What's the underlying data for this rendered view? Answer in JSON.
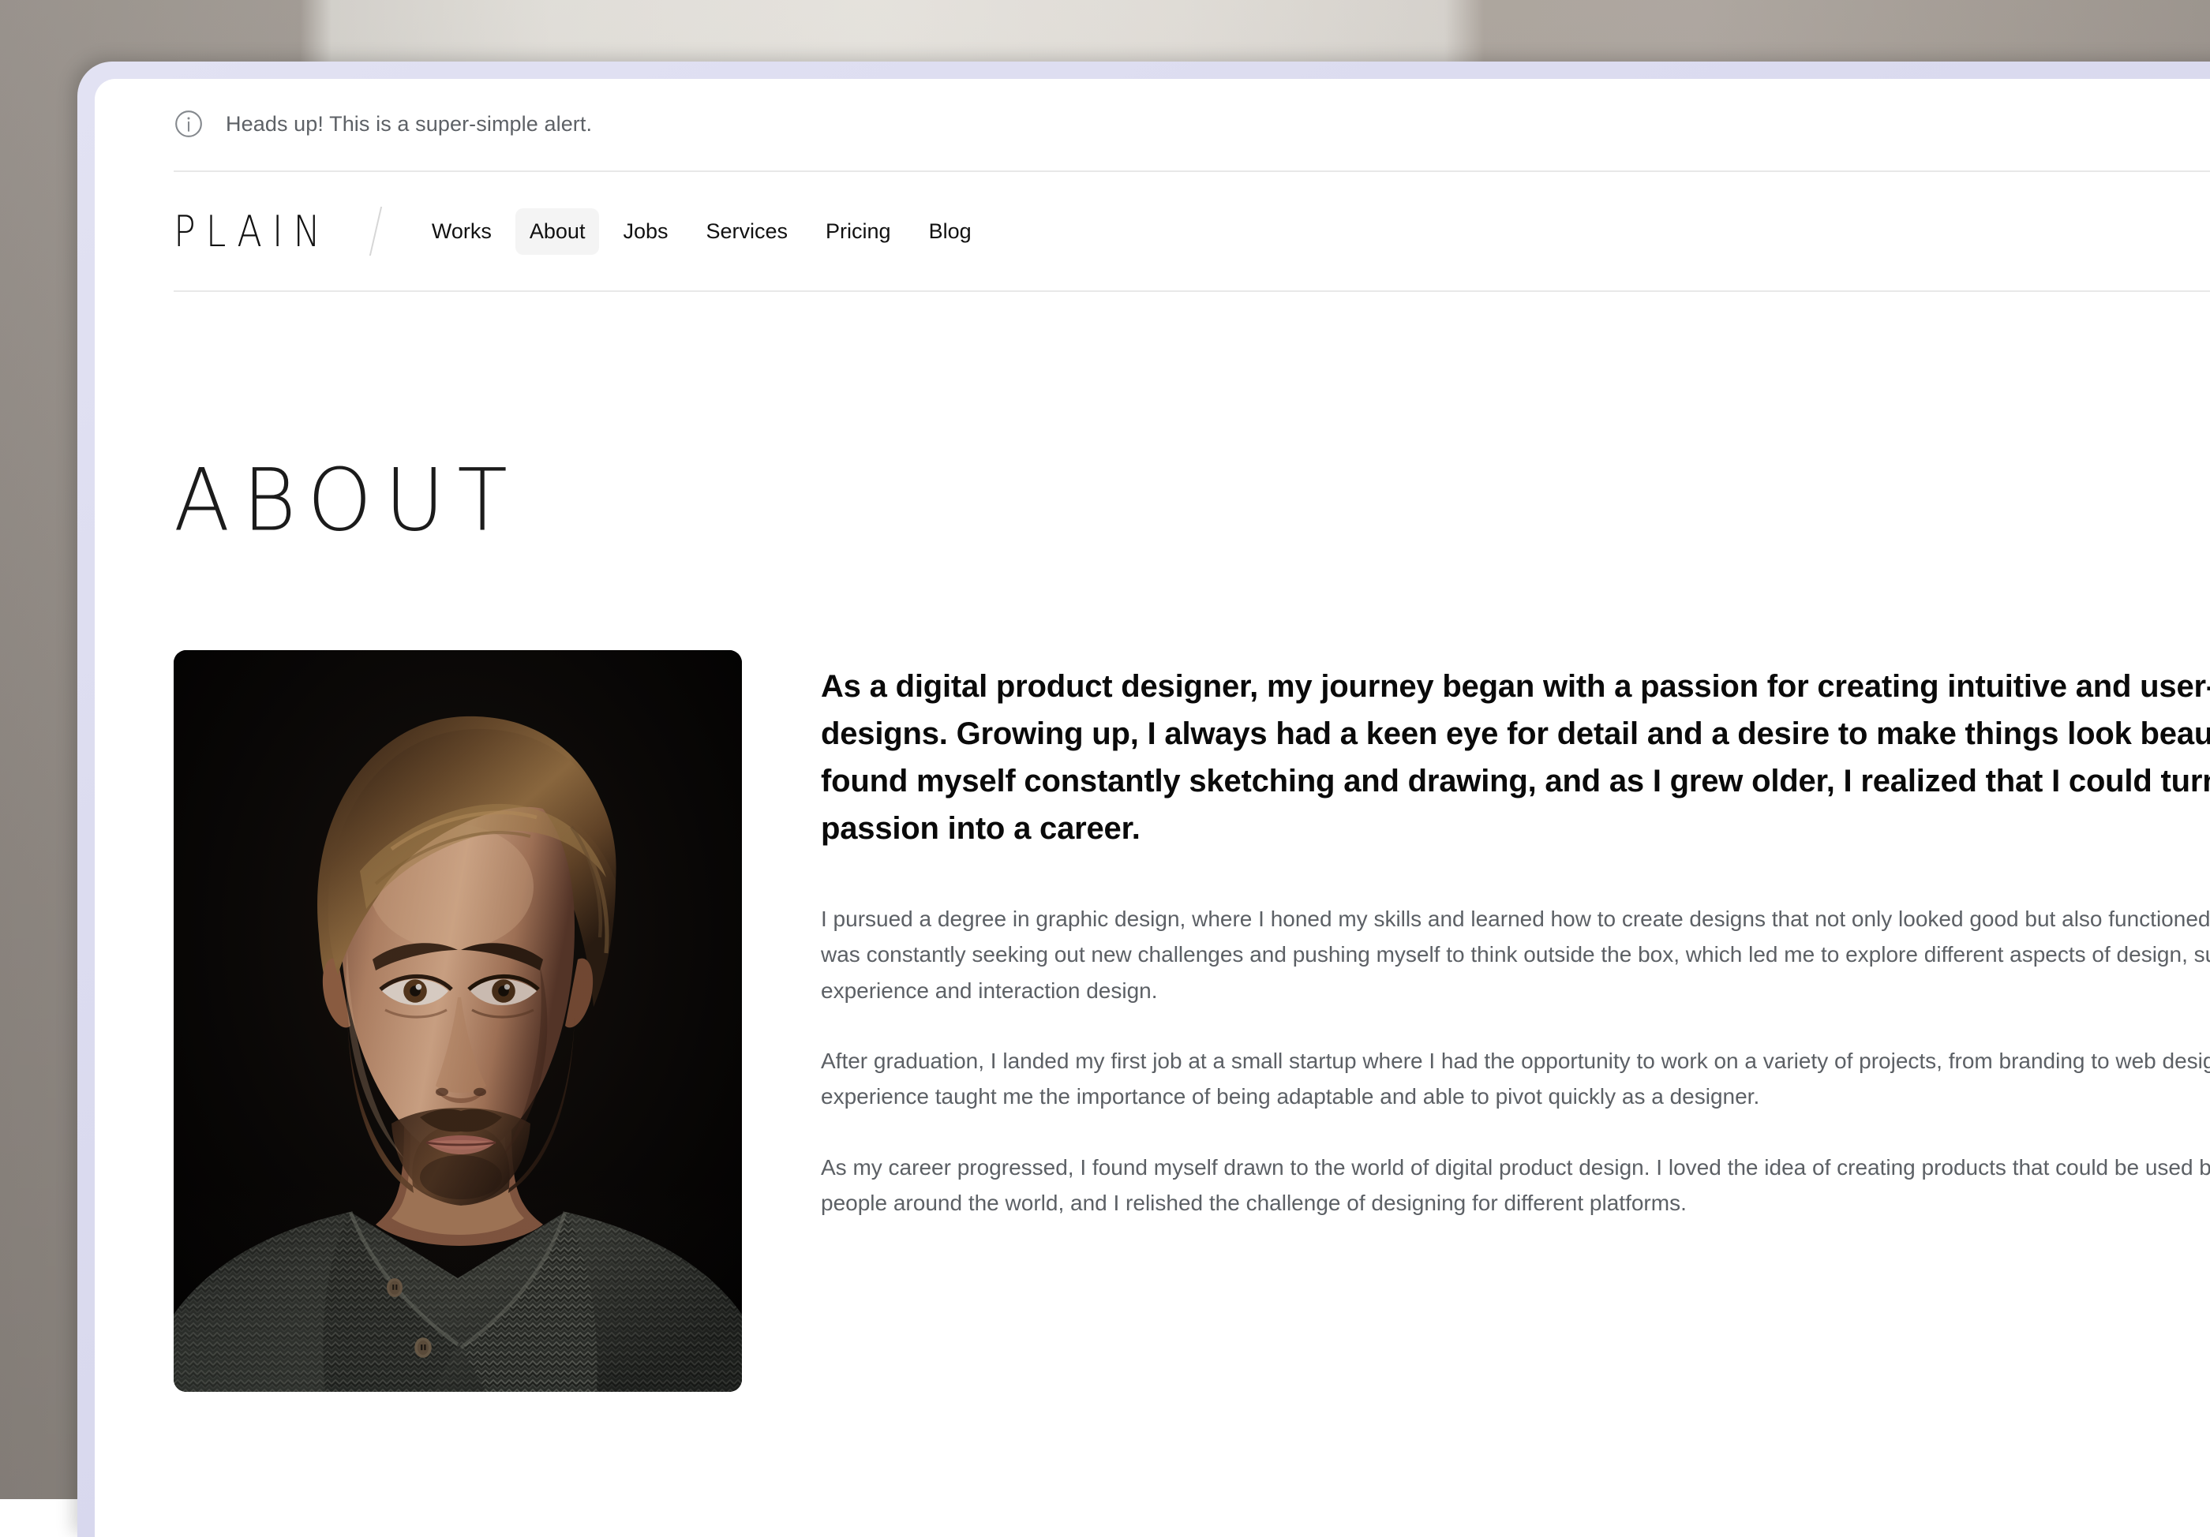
{
  "alert": {
    "icon": "info-circle-icon",
    "message": "Heads up! This is a super-simple alert."
  },
  "nav": {
    "logo": "PLAIN",
    "separator": "/",
    "links": [
      {
        "label": "Works",
        "active": false
      },
      {
        "label": "About",
        "active": true
      },
      {
        "label": "Jobs",
        "active": false
      },
      {
        "label": "Services",
        "active": false
      },
      {
        "label": "Pricing",
        "active": false
      },
      {
        "label": "Blog",
        "active": false
      }
    ]
  },
  "page": {
    "title": "ABOUT"
  },
  "portrait": {
    "alt": "Studio portrait of a bearded man in a grey knit shawl-collar sweater on a black background"
  },
  "article": {
    "lede": "As a digital product designer, my journey began with a passion for creating intuitive and user-friendly designs. Growing up, I always had a keen eye for detail and a desire to make things look beautiful. I found myself constantly sketching and drawing, and as I grew older, I realized that I could turn this passion into a career.",
    "paragraphs": [
      "I pursued a degree in graphic design, where I honed my skills and learned how to create designs that not only looked good but also functioned seamlessly. I was constantly seeking out new challenges and pushing myself to think outside the box, which led me to explore different aspects of design, such as user experience and interaction design.",
      "After graduation, I landed my first job at a small startup where I had the opportunity to work on a variety of projects, from branding to web design. This experience taught me the importance of being adaptable and able to pivot quickly as a designer.",
      "As my career progressed, I found myself drawn to the world of digital product design. I loved the idea of creating products that could be used by millions of people around the world, and I relished the challenge of designing for different platforms."
    ]
  },
  "colors": {
    "backdrop_left": "#918a84",
    "backdrop_center": "#e3e0da",
    "bezel": "#dcdcf0",
    "page_bg": "#ffffff",
    "rule": "#e8e8e8",
    "active_pill": "#f4f4f4",
    "body_text": "#5c6065",
    "heading_text": "#1b1b1b",
    "alert_text": "#5d6166"
  }
}
